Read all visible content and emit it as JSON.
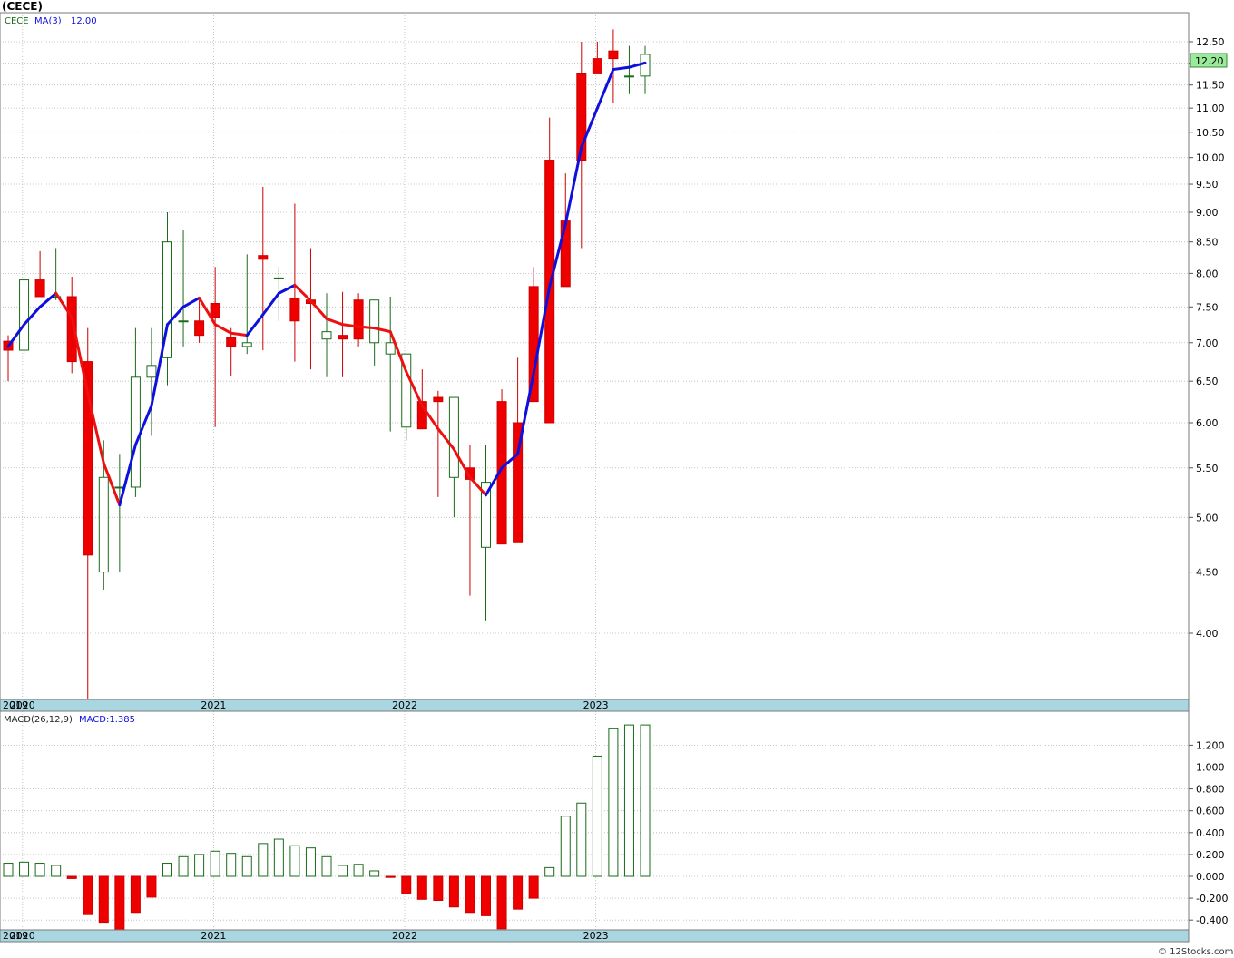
{
  "title": "(CECE)",
  "watermark": "© 12Stocks.com",
  "colors": {
    "up": "#1a6b1a",
    "down": "#cc0000",
    "down_fill": "#ee0000",
    "ma_up": "#1010dd",
    "ma_down": "#ee1010",
    "axis_band": "#a9d6e0",
    "grid": "#b8b8b8",
    "price_tag": "#9bea9b"
  },
  "price_panel": {
    "legend_symbol": "CECE",
    "legend_ma": "MA(3)",
    "legend_ma_value": "12.00",
    "last_price": "12.20",
    "ticks": [
      "4.00",
      "4.50",
      "5.00",
      "5.50",
      "6.00",
      "6.50",
      "7.00",
      "7.50",
      "8.00",
      "8.50",
      "9.00",
      "9.50",
      "10.00",
      "10.50",
      "11.00",
      "11.50",
      "12.00",
      "12.50"
    ]
  },
  "macd_panel": {
    "legend_name": "MACD(26,12,9)",
    "legend_value": "MACD:1.385",
    "ticks": [
      "-0.400",
      "-0.200",
      "0.000",
      "0.200",
      "0.400",
      "0.600",
      "0.800",
      "1.000",
      "1.200"
    ]
  },
  "x_axis_labels": [
    "2019",
    "2020",
    "2021",
    "2022",
    "2023"
  ],
  "chart_data": {
    "type": "candlestick",
    "title": "(CECE)",
    "periodicity": "monthly",
    "y_scale": "log",
    "ylim": [
      3.45,
      13.2
    ],
    "x": [
      "2019-12",
      "2020-01",
      "2020-02",
      "2020-03",
      "2020-04",
      "2020-05",
      "2020-06",
      "2020-07",
      "2020-08",
      "2020-09",
      "2020-10",
      "2020-11",
      "2020-12",
      "2021-01",
      "2021-02",
      "2021-03",
      "2021-04",
      "2021-05",
      "2021-06",
      "2021-07",
      "2021-08",
      "2021-09",
      "2021-10",
      "2021-11",
      "2021-12",
      "2022-01",
      "2022-02",
      "2022-03",
      "2022-04",
      "2022-05",
      "2022-06",
      "2022-07",
      "2022-08",
      "2022-09",
      "2022-10",
      "2022-11",
      "2022-12",
      "2023-01",
      "2023-02",
      "2023-03",
      "2023-04"
    ],
    "open": [
      7.02,
      6.9,
      7.9,
      7.65,
      7.65,
      6.75,
      4.5,
      5.3,
      5.3,
      6.55,
      6.8,
      7.3,
      7.3,
      7.55,
      7.07,
      6.95,
      8.28,
      7.93,
      7.62,
      7.6,
      7.05,
      7.1,
      7.6,
      7.0,
      6.85,
      5.95,
      6.25,
      6.3,
      5.4,
      5.5,
      4.72,
      6.25,
      6.0,
      7.8,
      9.95,
      8.85,
      11.75,
      12.1,
      12.28,
      11.7,
      11.7
    ],
    "high": [
      7.1,
      8.2,
      8.35,
      8.4,
      7.95,
      7.2,
      5.8,
      5.65,
      7.2,
      7.2,
      9.0,
      8.7,
      7.6,
      8.1,
      7.2,
      8.3,
      9.45,
      8.1,
      9.15,
      8.4,
      7.7,
      7.72,
      7.7,
      7.6,
      7.65,
      6.05,
      6.65,
      6.38,
      5.95,
      5.75,
      5.75,
      6.4,
      6.8,
      8.1,
      10.8,
      9.7,
      12.5,
      12.5,
      12.8,
      12.4,
      12.4
    ],
    "low": [
      6.5,
      6.85,
      7.65,
      7.6,
      6.6,
      3.45,
      4.35,
      4.5,
      5.2,
      5.85,
      6.45,
      6.95,
      7.0,
      5.95,
      6.57,
      6.85,
      6.9,
      7.3,
      6.75,
      6.65,
      6.55,
      6.55,
      6.95,
      6.7,
      5.9,
      5.8,
      5.95,
      5.2,
      5.0,
      4.3,
      4.1,
      5.8,
      5.7,
      6.95,
      7.25,
      8.6,
      8.4,
      11.9,
      11.1,
      11.3,
      11.3
    ],
    "close": [
      6.9,
      7.9,
      7.65,
      7.65,
      6.75,
      4.65,
      5.4,
      5.3,
      6.55,
      6.7,
      8.5,
      7.3,
      7.1,
      7.35,
      6.95,
      7.0,
      8.22,
      7.93,
      7.3,
      7.55,
      7.15,
      7.05,
      7.05,
      7.6,
      7.0,
      6.85,
      5.93,
      6.25,
      6.3,
      5.38,
      5.35,
      4.75,
      4.77,
      6.25,
      6.0,
      7.8,
      9.95,
      11.75,
      12.1,
      11.7,
      12.2
    ],
    "ma3": [
      6.95,
      7.25,
      7.5,
      7.7,
      7.35,
      6.35,
      5.55,
      5.12,
      5.75,
      6.2,
      7.25,
      7.5,
      7.63,
      7.25,
      7.13,
      7.1,
      7.39,
      7.7,
      7.82,
      7.59,
      7.33,
      7.25,
      7.22,
      7.2,
      7.15,
      6.62,
      6.2,
      5.93,
      5.7,
      5.4,
      5.22,
      5.5,
      5.65,
      6.6,
      7.8,
      8.8,
      10.2,
      11.0,
      11.85,
      11.9,
      12.0
    ],
    "macd": {
      "name": "MACD(26,12,9)",
      "values": [
        0.12,
        0.13,
        0.12,
        0.1,
        -0.02,
        -0.35,
        -0.42,
        -0.5,
        -0.33,
        -0.19,
        0.12,
        0.18,
        0.2,
        0.23,
        0.21,
        0.18,
        0.3,
        0.34,
        0.28,
        0.26,
        0.18,
        0.1,
        0.11,
        0.05,
        -0.01,
        -0.16,
        -0.21,
        -0.22,
        -0.28,
        -0.33,
        -0.36,
        -0.48,
        -0.3,
        -0.2,
        0.08,
        0.55,
        0.67,
        1.1,
        1.35,
        1.385,
        1.385
      ],
      "ylim": [
        -0.48,
        1.38
      ]
    }
  }
}
